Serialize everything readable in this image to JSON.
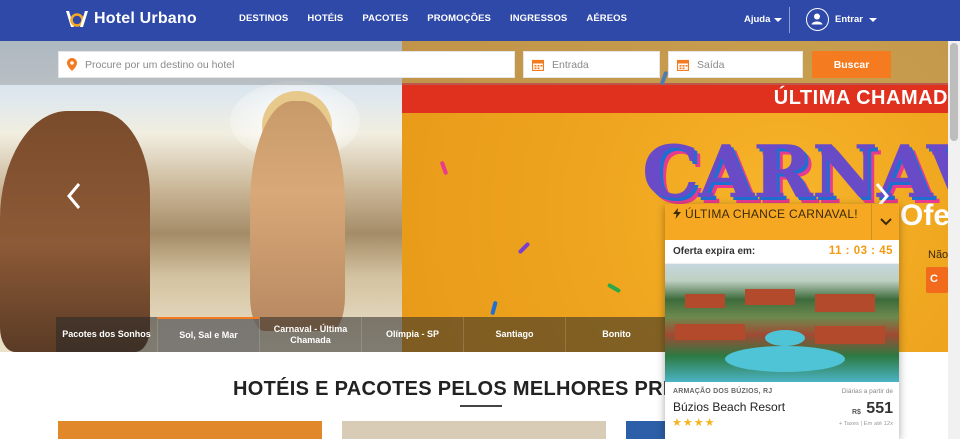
{
  "brand": {
    "name": "Hotel Urbano"
  },
  "nav": {
    "items": [
      "DESTINOS",
      "HOTÉIS",
      "PACOTES",
      "PROMOÇÕES",
      "INGRESSOS",
      "AÉREOS"
    ],
    "help_label": "Ajuda",
    "user_label": "Entrar"
  },
  "search": {
    "destination_placeholder": "Procure por um destino ou hotel",
    "checkin_placeholder": "Entrada",
    "checkout_placeholder": "Saída",
    "button_label": "Buscar"
  },
  "hero": {
    "promo_title": "ÚLTIMA CHAMAD",
    "carnaval_text": "CARNAV",
    "oferta_text": "Ofe",
    "nao_text": "Não",
    "cta_text": "C"
  },
  "categories": [
    {
      "label": "Pacotes dos Sonhos",
      "active": false
    },
    {
      "label": "Sol, Sal e Mar",
      "active": true
    },
    {
      "label": "Carnaval - Última Chamada",
      "active": false
    },
    {
      "label": "Olímpia - SP",
      "active": false
    },
    {
      "label": "Santiago",
      "active": false
    },
    {
      "label": "Bonito",
      "active": false
    }
  ],
  "section": {
    "title": "HOTÉIS E PACOTES PELOS MELHORES PRE"
  },
  "offer": {
    "title": "ÚLTIMA CHANCE CARNAVAL!",
    "expire_label": "Oferta expira em:",
    "timer": "11 : 03 : 45",
    "location": "ARMAÇÃO DOS BÚZIOS, RJ",
    "price_from": "Diárias a partir de",
    "hotel_name": "Búzios Beach Resort",
    "currency": "R$",
    "price": "551",
    "stars": 4,
    "taxes_note": "+ Taxes | Em até 12x"
  },
  "colors": {
    "nav_bg": "#2f49a8",
    "accent": "#f47b20",
    "offer_header": "#f6a823",
    "timer": "#f39a10"
  }
}
